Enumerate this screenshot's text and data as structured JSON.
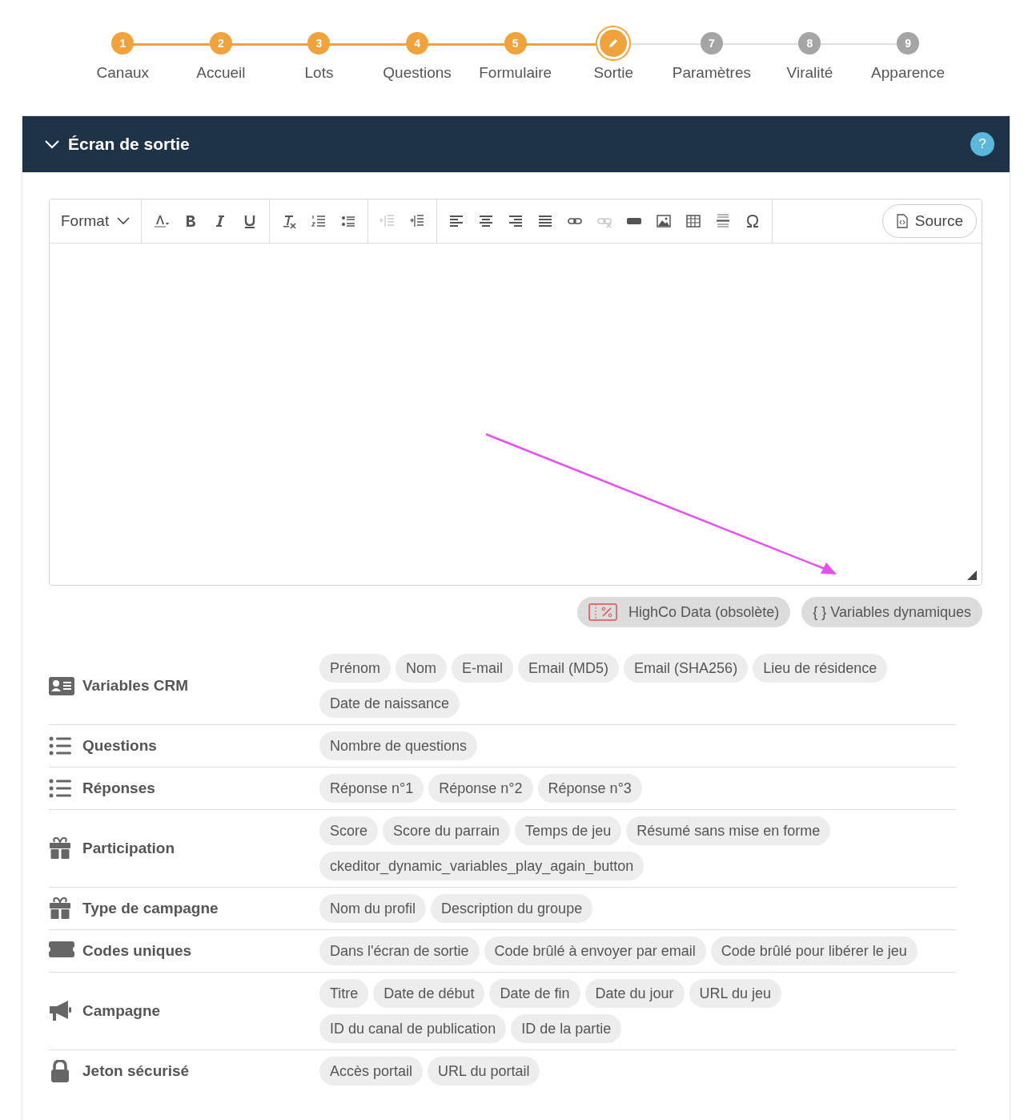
{
  "steps": [
    {
      "number": "1",
      "label": "Canaux",
      "kind": "done"
    },
    {
      "number": "2",
      "label": "Accueil",
      "kind": "done"
    },
    {
      "number": "3",
      "label": "Lots",
      "kind": "done"
    },
    {
      "number": "4",
      "label": "Questions",
      "kind": "done"
    },
    {
      "number": "5",
      "label": "Formulaire",
      "kind": "done"
    },
    {
      "label": "Sortie",
      "kind": "current"
    },
    {
      "number": "7",
      "label": "Paramètres",
      "kind": "todo"
    },
    {
      "number": "8",
      "label": "Viralité",
      "kind": "todo"
    },
    {
      "number": "9",
      "label": "Apparence",
      "kind": "todo"
    }
  ],
  "panel": {
    "title": "Écran de sortie",
    "expanded": true,
    "help": "?"
  },
  "editor": {
    "format_label": "Format",
    "source_label": "Source",
    "toolbar": [
      {
        "kind": "text-color",
        "disabled": false
      },
      {
        "kind": "bold",
        "disabled": false
      },
      {
        "kind": "italic",
        "disabled": false
      },
      {
        "kind": "underline",
        "disabled": false
      },
      {
        "kind": "clear-format",
        "disabled": false
      },
      {
        "kind": "ordered-list",
        "disabled": false
      },
      {
        "kind": "bullet-list",
        "disabled": false
      },
      {
        "kind": "outdent",
        "disabled": true
      },
      {
        "kind": "indent",
        "disabled": false
      },
      {
        "kind": "align-left",
        "disabled": false
      },
      {
        "kind": "align-center",
        "disabled": false
      },
      {
        "kind": "align-right",
        "disabled": false
      },
      {
        "kind": "justify",
        "disabled": false
      },
      {
        "kind": "link",
        "disabled": false
      },
      {
        "kind": "unlink",
        "disabled": true
      },
      {
        "kind": "button",
        "disabled": false
      },
      {
        "kind": "image",
        "disabled": false
      },
      {
        "kind": "table",
        "disabled": false
      },
      {
        "kind": "horizontal-rule",
        "disabled": false
      },
      {
        "kind": "special-char",
        "disabled": false
      }
    ],
    "actions": [
      {
        "kind": "coupon",
        "label": "HighCo Data (obsolète)"
      },
      {
        "kind": "braces",
        "label": "{ } Variables dynamiques"
      }
    ]
  },
  "categories": [
    {
      "kind": "id-card",
      "title": "Variables CRM",
      "chips": [
        "Prénom",
        "Nom",
        "E-mail",
        "Email (MD5)",
        "Email (SHA256)",
        "Lieu de résidence",
        "Date de naissance"
      ]
    },
    {
      "kind": "list",
      "title": "Questions",
      "chips": [
        "Nombre de questions"
      ]
    },
    {
      "kind": "list",
      "title": "Réponses",
      "chips": [
        "Réponse n°1",
        "Réponse n°2",
        "Réponse n°3"
      ]
    },
    {
      "kind": "gift",
      "title": "Participation",
      "chips": [
        "Score",
        "Score du parrain",
        "Temps de jeu",
        "Résumé sans mise en forme",
        "ckeditor_dynamic_variables_play_again_button"
      ]
    },
    {
      "kind": "gift",
      "title": "Type de campagne",
      "chips": [
        "Nom du profil",
        "Description du groupe"
      ]
    },
    {
      "kind": "ticket",
      "title": "Codes uniques",
      "chips": [
        "Dans l'écran de sortie",
        "Code brûlé à envoyer par email",
        "Code brûlé pour libérer le jeu"
      ]
    },
    {
      "kind": "megaphone",
      "title": "Campagne",
      "chips": [
        "Titre",
        "Date de début",
        "Date de fin",
        "Date du jour",
        "URL du jeu",
        "ID du canal de publication",
        "ID de la partie"
      ]
    },
    {
      "kind": "lock",
      "title": "Jeton sécurisé",
      "chips": [
        "Accès portail",
        "URL du portail"
      ]
    }
  ]
}
